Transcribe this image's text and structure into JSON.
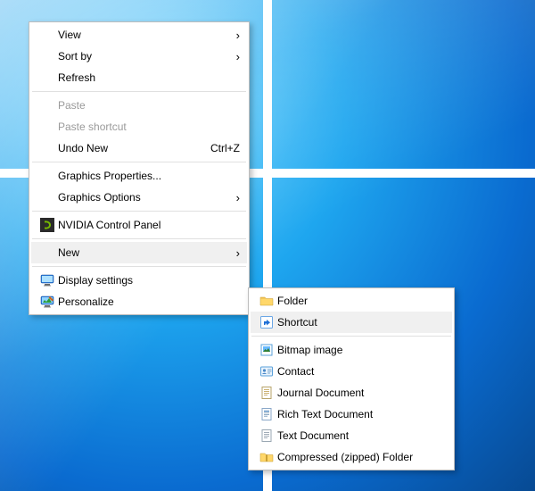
{
  "main_menu": {
    "view": "View",
    "sort_by": "Sort by",
    "refresh": "Refresh",
    "paste": "Paste",
    "paste_shortcut": "Paste shortcut",
    "undo_new": "Undo New",
    "undo_new_accel": "Ctrl+Z",
    "graphics_properties": "Graphics Properties...",
    "graphics_options": "Graphics Options",
    "nvidia_control_panel": "NVIDIA Control Panel",
    "new": "New",
    "display_settings": "Display settings",
    "personalize": "Personalize"
  },
  "new_submenu": {
    "folder": "Folder",
    "shortcut": "Shortcut",
    "bitmap_image": "Bitmap image",
    "contact": "Contact",
    "journal_document": "Journal Document",
    "rich_text_document": "Rich Text Document",
    "text_document": "Text Document",
    "compressed_folder": "Compressed (zipped) Folder"
  },
  "glyphs": {
    "submenu_arrow": "›"
  }
}
